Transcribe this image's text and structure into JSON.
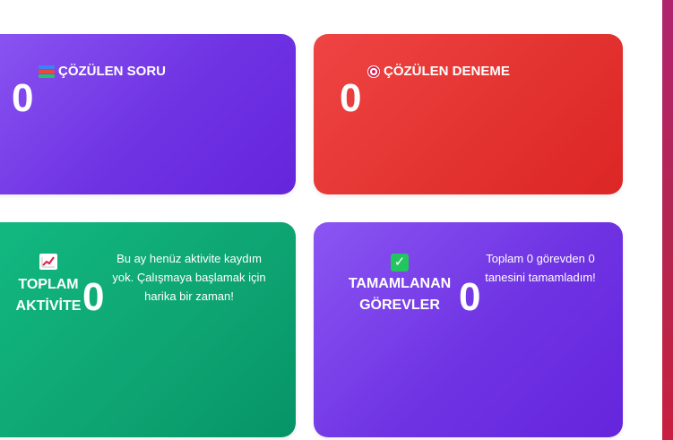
{
  "cards": [
    {
      "id": "solved-questions",
      "icon": "books-icon",
      "title": "ÇÖZÜLEN SORU",
      "value": "0"
    },
    {
      "id": "solved-exams",
      "icon": "target-icon",
      "title": "ÇÖZÜLEN DENEME",
      "value": "0"
    },
    {
      "id": "total-activity",
      "icon": "chart-increasing-icon",
      "title_line1": "TOPLAM",
      "title_line2": "AKTİVİTE",
      "value": "0",
      "description": "Bu ay henüz aktivite kaydım yok. Çalışmaya başlamak için harika bir zaman!"
    },
    {
      "id": "completed-tasks",
      "icon": "check-mark-icon",
      "title_line1": "TAMAMLANAN",
      "title_line2": "GÖREVLER",
      "value": "0",
      "description": "Toplam 0 görevden 0 tanesini tamamladım!"
    }
  ],
  "colors": {
    "purple": "#7c3aed",
    "red": "#ef4444",
    "green": "#10b981",
    "side_accent": "#be185d"
  }
}
